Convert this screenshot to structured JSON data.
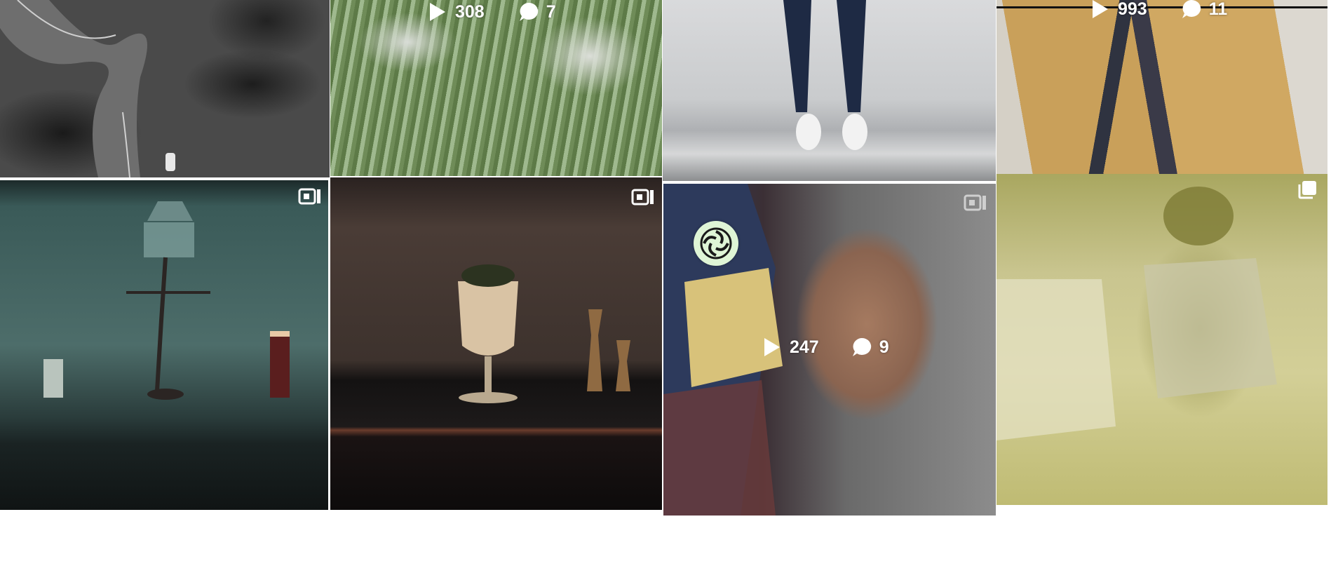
{
  "grid": {
    "tiles": [
      {
        "id": "t1",
        "media_type": "photo",
        "plays": null,
        "comments": null,
        "hover": false,
        "badge": null
      },
      {
        "id": "t2",
        "media_type": "video",
        "plays": "308",
        "comments": "7",
        "hover": true,
        "badge": null
      },
      {
        "id": "t3",
        "media_type": "photo",
        "plays": null,
        "comments": null,
        "hover": false,
        "badge": null
      },
      {
        "id": "t4",
        "media_type": "video",
        "plays": "993",
        "comments": "11",
        "hover": true,
        "badge": null
      },
      {
        "id": "t5",
        "media_type": "video",
        "plays": null,
        "comments": null,
        "hover": false,
        "badge": "igtv-icon"
      },
      {
        "id": "t6",
        "media_type": "video",
        "plays": null,
        "comments": null,
        "hover": false,
        "badge": "igtv-icon"
      },
      {
        "id": "t7",
        "media_type": "video",
        "plays": "247",
        "comments": "9",
        "hover": true,
        "badge": "igtv-icon"
      },
      {
        "id": "t8",
        "media_type": "carousel",
        "plays": null,
        "comments": null,
        "hover": false,
        "badge": "carousel-icon"
      }
    ]
  },
  "overlay": {
    "icon": "swirl-logo-icon"
  },
  "colors": {
    "overlay_text": "#ffffff",
    "page_background": "#ffffff"
  }
}
